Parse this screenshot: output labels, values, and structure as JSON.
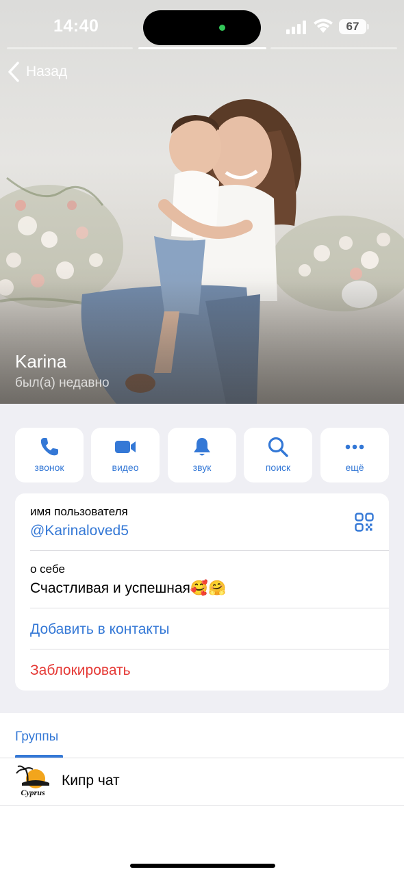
{
  "status_bar": {
    "time": "14:40",
    "battery": "67",
    "icons": [
      "cellular-signal-icon",
      "wifi-icon",
      "battery-icon"
    ]
  },
  "nav": {
    "back_label": "Назад",
    "back_icon": "chevron-left-icon"
  },
  "profile": {
    "name": "Karina",
    "last_seen": "был(а) недавно"
  },
  "actions": [
    {
      "label": "звонок",
      "icon": "phone-icon"
    },
    {
      "label": "видео",
      "icon": "video-camera-icon"
    },
    {
      "label": "звук",
      "icon": "bell-icon"
    },
    {
      "label": "поиск",
      "icon": "search-icon"
    },
    {
      "label": "ещё",
      "icon": "more-dots-icon"
    }
  ],
  "info": {
    "username_label": "имя пользователя",
    "username": "@Karinaloved5",
    "bio_label": "о себе",
    "bio": "Счастливая и успешная🥰🤗",
    "add_contact": "Добавить в контакты",
    "block": "Заблокировать"
  },
  "groups": {
    "tab_label": "Группы",
    "items": [
      {
        "name": "Кипр чат",
        "avatar_text": "Cyprus"
      }
    ]
  },
  "colors": {
    "accent": "#3478d6",
    "destructive": "#e53935",
    "background": "#efeff4",
    "card": "#ffffff"
  }
}
